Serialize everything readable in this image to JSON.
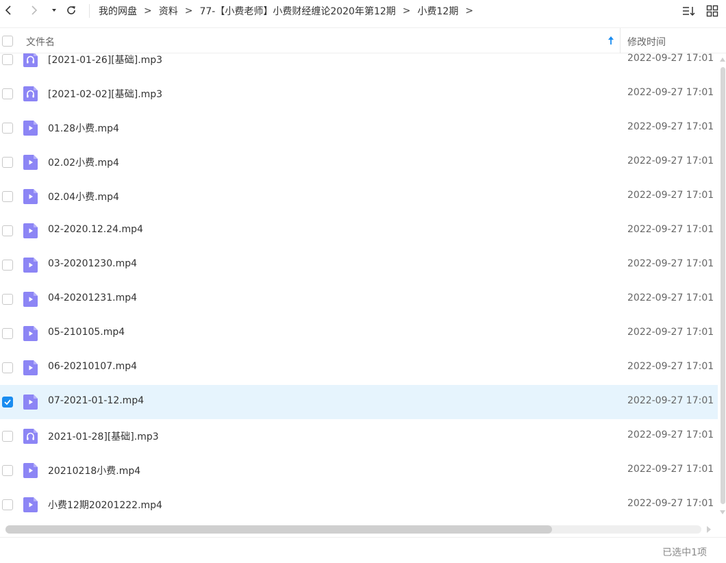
{
  "toolbar": {
    "back_icon": "chevron-left-icon",
    "forward_icon": "chevron-right-icon",
    "history_icon": "caret-down-icon",
    "refresh_icon": "refresh-icon",
    "sort_icon": "sort-list-icon",
    "view_icon": "grid-view-icon"
  },
  "breadcrumb": {
    "items": [
      "我的网盘",
      "资料",
      "77-【小费老师】小费财经缠论2020年第12期",
      "小费12期"
    ],
    "separator": ">"
  },
  "header": {
    "name_label": "文件名",
    "time_label": "修改时间",
    "sort_icon": "arrow-up-icon"
  },
  "files": [
    {
      "name": " [2021-01-26][基础].mp3",
      "type": "audio",
      "time": "2022-09-27 17:01",
      "selected": false
    },
    {
      "name": "[2021-02-02][基础].mp3",
      "type": "audio",
      "time": "2022-09-27 17:01",
      "selected": false
    },
    {
      "name": "01.28小费.mp4",
      "type": "video",
      "time": "2022-09-27 17:01",
      "selected": false
    },
    {
      "name": "02.02小费.mp4",
      "type": "video",
      "time": "2022-09-27 17:01",
      "selected": false
    },
    {
      "name": "02.04小费.mp4",
      "type": "video",
      "time": "2022-09-27 17:01",
      "selected": false
    },
    {
      "name": "02-2020.12.24.mp4",
      "type": "video",
      "time": "2022-09-27 17:01",
      "selected": false
    },
    {
      "name": "03-20201230.mp4",
      "type": "video",
      "time": "2022-09-27 17:01",
      "selected": false
    },
    {
      "name": "04-20201231.mp4",
      "type": "video",
      "time": "2022-09-27 17:01",
      "selected": false
    },
    {
      "name": "05-210105.mp4",
      "type": "video",
      "time": "2022-09-27 17:01",
      "selected": false
    },
    {
      "name": "06-20210107.mp4",
      "type": "video",
      "time": "2022-09-27 17:01",
      "selected": false
    },
    {
      "name": "07-2021-01-12.mp4",
      "type": "video",
      "time": "2022-09-27 17:01",
      "selected": true
    },
    {
      "name": "2021-01-28][基础].mp3",
      "type": "audio",
      "time": "2022-09-27 17:01",
      "selected": false
    },
    {
      "name": "20210218小费.mp4",
      "type": "video",
      "time": "2022-09-27 17:01",
      "selected": false
    },
    {
      "name": "小费12期20201222.mp4",
      "type": "video",
      "time": "2022-09-27 17:01",
      "selected": false
    }
  ],
  "status": {
    "selection_text": "已选中1项"
  },
  "colors": {
    "accent": "#1a8cf0",
    "selected_row": "#e6f4fd",
    "file_icon": "#8c85f5"
  }
}
